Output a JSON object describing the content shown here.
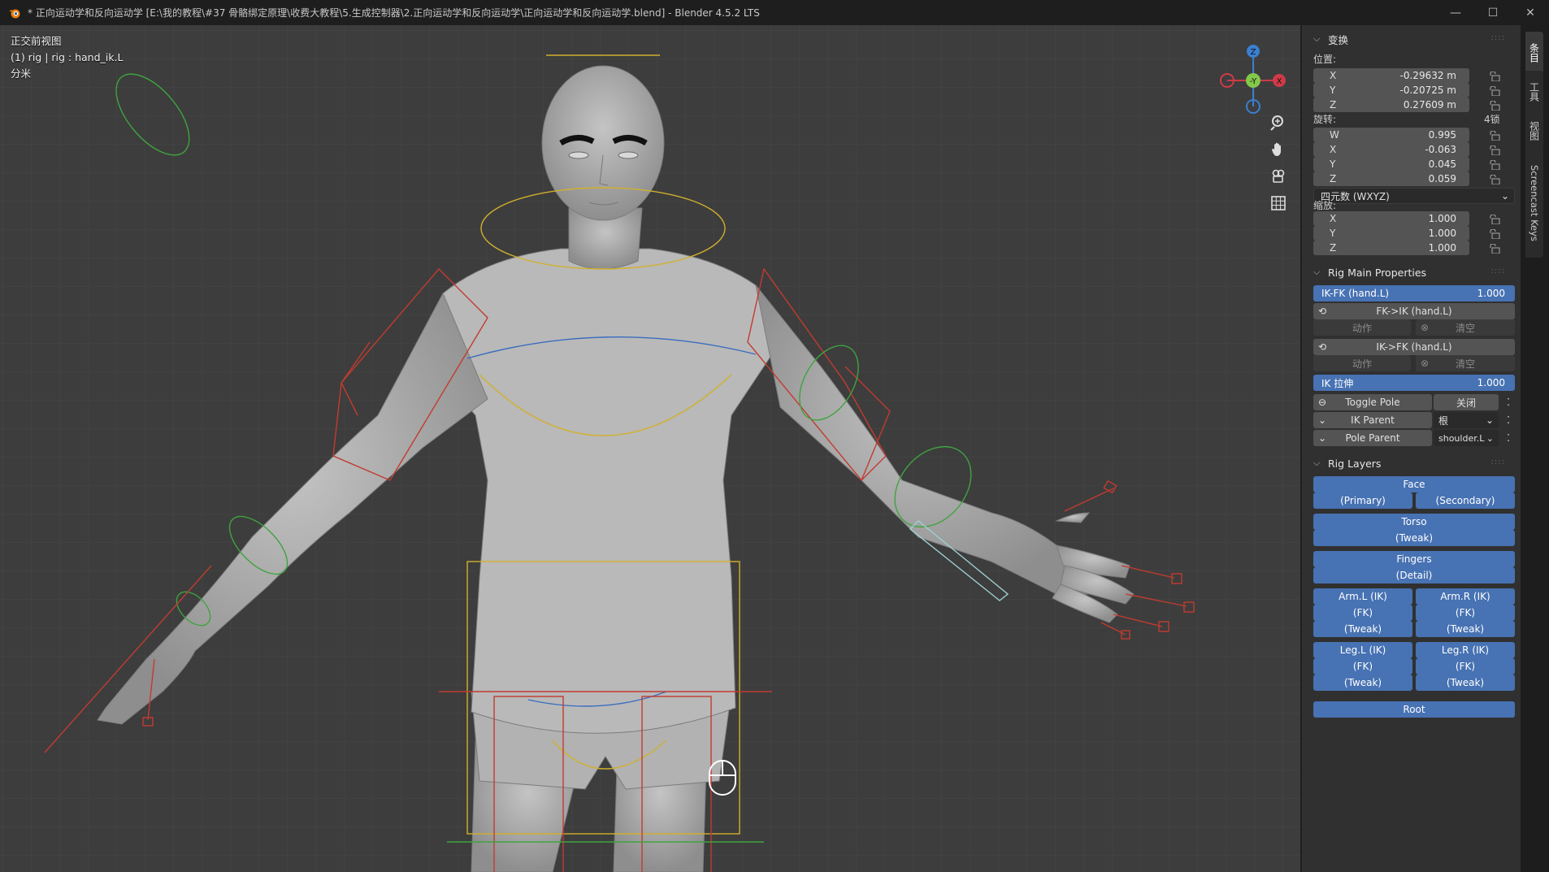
{
  "window": {
    "title": "* 正向运动学和反向运动学 [E:\\我的教程\\#37 骨骼绑定原理\\收费大教程\\5.生成控制器\\2.正向运动学和反向运动学\\正向运动学和反向运动学.blend] - Blender 4.5.2 LTS",
    "minimize": "—",
    "maximize": "☐",
    "close": "✕"
  },
  "viewport": {
    "view_name": "正交前视图",
    "object_info": "(1) rig | rig : hand_ik.L",
    "unit": "分米",
    "gizmo": {
      "z": "Z",
      "y": "-Y",
      "x": "X"
    }
  },
  "tabs": [
    "条目",
    "工具",
    "视图",
    "Screencast Keys"
  ],
  "transform": {
    "header": "变换",
    "location_label": "位置:",
    "location": [
      {
        "axis": "X",
        "value": "-0.29632 m"
      },
      {
        "axis": "Y",
        "value": "-0.20725 m"
      },
      {
        "axis": "Z",
        "value": "0.27609 m"
      }
    ],
    "rotation_label": "旋转:",
    "rotation_lock_label": "4锁",
    "rotation": [
      {
        "axis": "W",
        "value": "0.995"
      },
      {
        "axis": "X",
        "value": "-0.063"
      },
      {
        "axis": "Y",
        "value": "0.045"
      },
      {
        "axis": "Z",
        "value": "0.059"
      }
    ],
    "rotation_mode": "四元数 (WXYZ)",
    "scale_label": "缩放:",
    "scale": [
      {
        "axis": "X",
        "value": "1.000"
      },
      {
        "axis": "Y",
        "value": "1.000"
      },
      {
        "axis": "Z",
        "value": "1.000"
      }
    ]
  },
  "rig_main": {
    "header": "Rig Main Properties",
    "ikfk": {
      "label": "IK-FK (hand.L)",
      "value": "1.000"
    },
    "fk_to_ik": "FK->IK (hand.L)",
    "ik_to_fk": "IK->FK (hand.L)",
    "action_label": "动作",
    "clear_label": "清空",
    "ik_stretch": {
      "label": "IK 拉伸",
      "value": "1.000"
    },
    "toggle_pole": {
      "label": "Toggle Pole",
      "value": "关闭"
    },
    "ik_parent": {
      "label": "IK Parent",
      "value": "根"
    },
    "pole_parent": {
      "label": "Pole Parent",
      "value": "shoulder.L"
    }
  },
  "rig_layers": {
    "header": "Rig Layers",
    "face": "Face",
    "primary": "(Primary)",
    "secondary": "(Secondary)",
    "torso": "Torso",
    "torso_tweak": "(Tweak)",
    "fingers": "Fingers",
    "detail": "(Detail)",
    "arm_l_ik": "Arm.L (IK)",
    "arm_r_ik": "Arm.R (IK)",
    "fk": "(FK)",
    "tweak": "(Tweak)",
    "leg_l_ik": "Leg.L (IK)",
    "leg_r_ik": "Leg.R (IK)",
    "root": "Root"
  }
}
